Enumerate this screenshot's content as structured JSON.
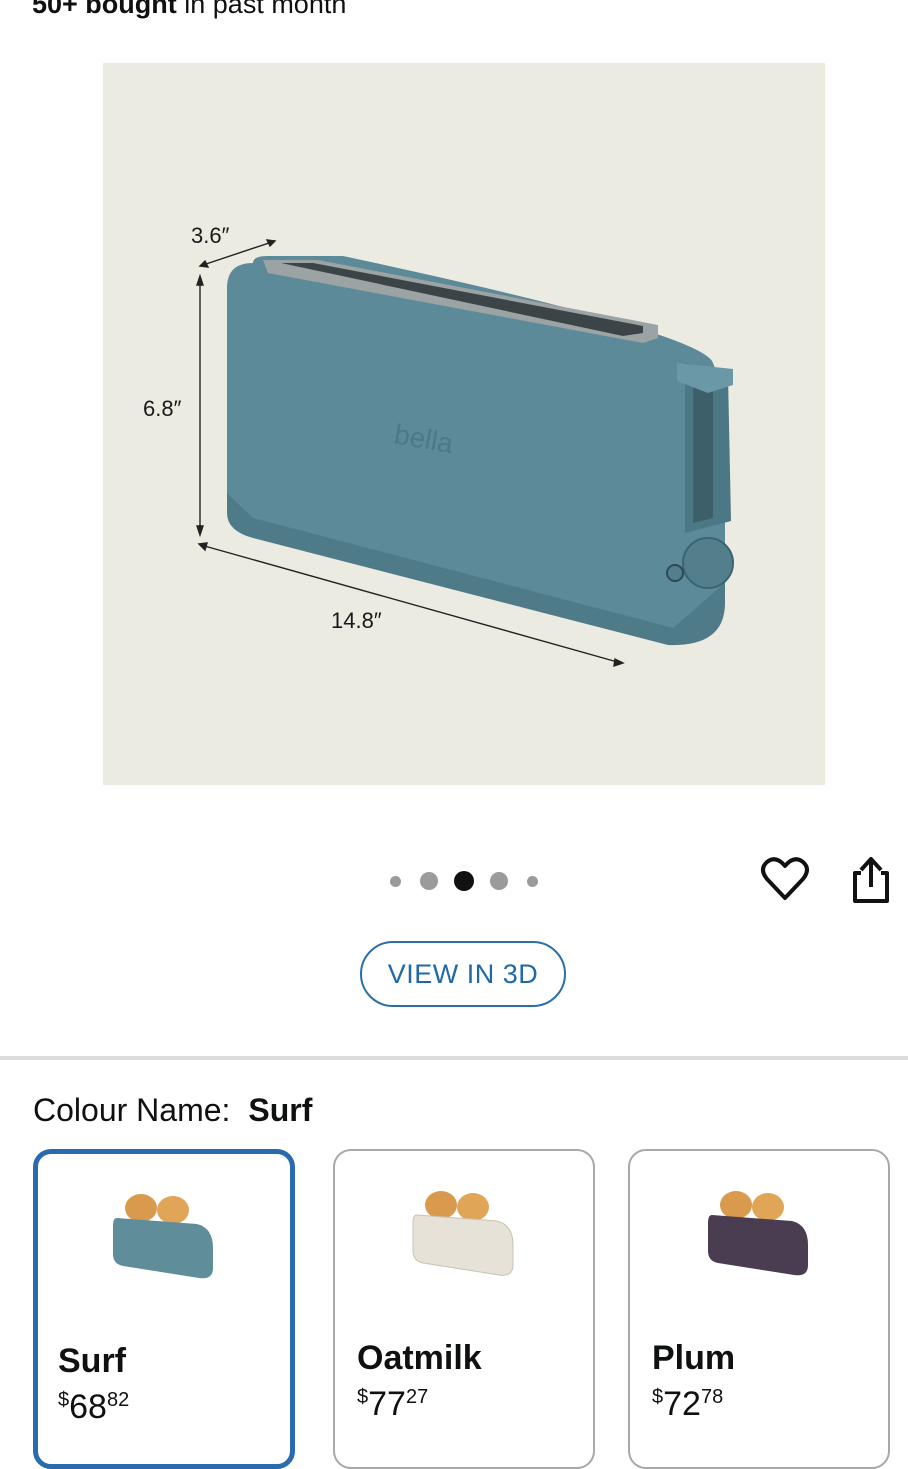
{
  "social_proof": {
    "bold": "50+ bought",
    "rest": " in past month"
  },
  "hero": {
    "dims": {
      "depth": "3.6″",
      "height": "6.8″",
      "width": "14.8″"
    },
    "brand": "bella",
    "colors": {
      "background": "#ebebe2",
      "toaster": "#5d8a98"
    }
  },
  "carousel": {
    "count": 5,
    "active_index": 2
  },
  "actions": {
    "view3d_label": "VIEW IN 3D"
  },
  "colour": {
    "label": "Colour Name:",
    "selected": "Surf",
    "options": [
      {
        "name": "Surf",
        "currency": "$",
        "dollars": "68",
        "cents": "82",
        "color": "#5f8d9a"
      },
      {
        "name": "Oatmilk",
        "currency": "$",
        "dollars": "77",
        "cents": "27",
        "color": "#e7e2d8"
      },
      {
        "name": "Plum",
        "currency": "$",
        "dollars": "72",
        "cents": "78",
        "color": "#4a3d52"
      }
    ]
  },
  "accent_colors": {
    "primary_blue": "#2a6bb0"
  }
}
